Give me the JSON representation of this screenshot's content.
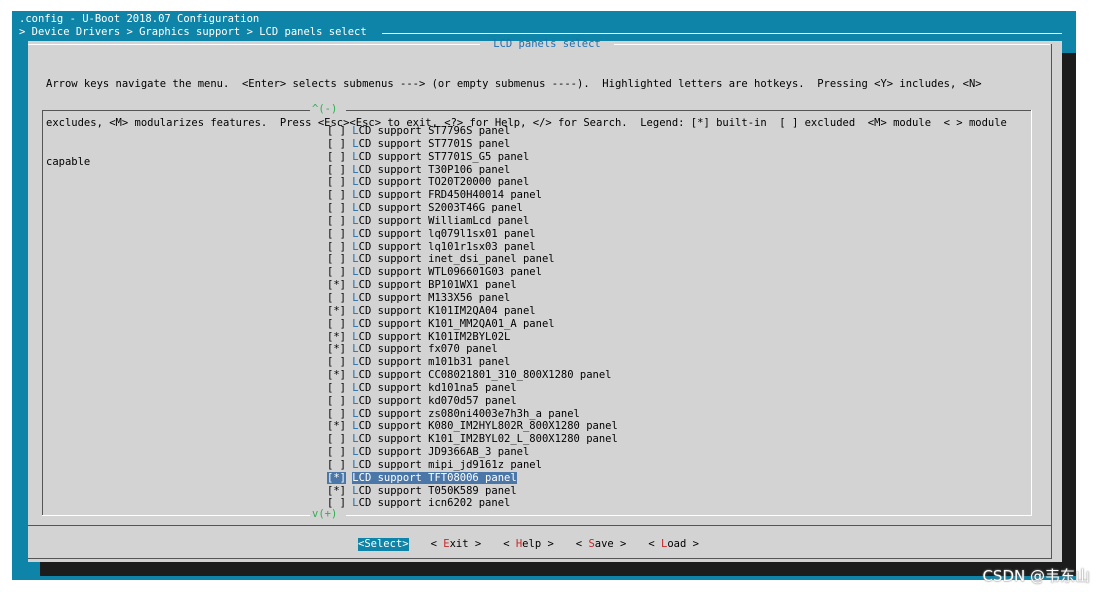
{
  "header": {
    "line1": ".config - U-Boot 2018.07 Configuration",
    "line2": "> Device Drivers > Graphics support > LCD panels select"
  },
  "dialog": {
    "title": "LCD panels select",
    "help": [
      "Arrow keys navigate the menu.  <Enter> selects submenus ---> (or empty submenus ----).  Highlighted letters are hotkeys.  Pressing <Y> includes, <N>",
      "excludes, <M> modularizes features.  Press <Esc><Esc> to exit, <?> for Help, </> for Search.  Legend: [*] built-in  [ ] excluded  <M> module  < > module",
      "capable"
    ],
    "scroll_up": "^(-)",
    "scroll_down": "v(+)"
  },
  "items": [
    {
      "mark": "[ ]",
      "hotkey": "L",
      "rest": "CD support ST7796S panel"
    },
    {
      "mark": "[ ]",
      "hotkey": "L",
      "rest": "CD support ST7701S panel"
    },
    {
      "mark": "[ ]",
      "hotkey": "L",
      "rest": "CD support ST7701S_G5 panel"
    },
    {
      "mark": "[ ]",
      "hotkey": "L",
      "rest": "CD support T30P106 panel"
    },
    {
      "mark": "[ ]",
      "hotkey": "L",
      "rest": "CD support TO20T20000 panel"
    },
    {
      "mark": "[ ]",
      "hotkey": "L",
      "rest": "CD support FRD450H40014 panel"
    },
    {
      "mark": "[ ]",
      "hotkey": "L",
      "rest": "CD support S2003T46G panel"
    },
    {
      "mark": "[ ]",
      "hotkey": "L",
      "rest": "CD support WilliamLcd panel"
    },
    {
      "mark": "[ ]",
      "hotkey": "L",
      "rest": "CD support lq079l1sx01 panel"
    },
    {
      "mark": "[ ]",
      "hotkey": "L",
      "rest": "CD support lq101r1sx03 panel"
    },
    {
      "mark": "[ ]",
      "hotkey": "L",
      "rest": "CD support inet_dsi_panel panel"
    },
    {
      "mark": "[ ]",
      "hotkey": "L",
      "rest": "CD support WTL096601G03 panel"
    },
    {
      "mark": "[*]",
      "hotkey": "L",
      "rest": "CD support BP101WX1 panel"
    },
    {
      "mark": "[ ]",
      "hotkey": "L",
      "rest": "CD support M133X56 panel"
    },
    {
      "mark": "[*]",
      "hotkey": "L",
      "rest": "CD support K101IM2QA04 panel"
    },
    {
      "mark": "[ ]",
      "hotkey": "L",
      "rest": "CD support K101_MM2QA01_A panel"
    },
    {
      "mark": "[*]",
      "hotkey": "L",
      "rest": "CD support K101IM2BYL02L"
    },
    {
      "mark": "[*]",
      "hotkey": "L",
      "rest": "CD support fx070 panel"
    },
    {
      "mark": "[ ]",
      "hotkey": "L",
      "rest": "CD support m101b31 panel"
    },
    {
      "mark": "[*]",
      "hotkey": "L",
      "rest": "CD support CC08021801_310_800X1280 panel"
    },
    {
      "mark": "[ ]",
      "hotkey": "L",
      "rest": "CD support kd101na5 panel"
    },
    {
      "mark": "[ ]",
      "hotkey": "L",
      "rest": "CD support kd070d57 panel"
    },
    {
      "mark": "[ ]",
      "hotkey": "L",
      "rest": "CD support zs080ni4003e7h3h_a panel"
    },
    {
      "mark": "[*]",
      "hotkey": "L",
      "rest": "CD support K080_IM2HYL802R_800X1280 panel"
    },
    {
      "mark": "[ ]",
      "hotkey": "L",
      "rest": "CD support K101_IM2BYL02_L_800X1280 panel"
    },
    {
      "mark": "[ ]",
      "hotkey": "L",
      "rest": "CD support JD9366AB_3 panel"
    },
    {
      "mark": "[ ]",
      "hotkey": "L",
      "rest": "CD support mipi_jd9161z panel"
    },
    {
      "mark": "[*]",
      "hotkey": "L",
      "rest": "CD support TFT08006 panel",
      "selected": true
    },
    {
      "mark": "[*]",
      "hotkey": "L",
      "rest": "CD support T050K589 panel"
    },
    {
      "mark": "[ ]",
      "hotkey": "L",
      "rest": "CD support icn6202 panel"
    }
  ],
  "buttons": [
    {
      "pre": "<",
      "hotkey": "S",
      "rest": "elect>",
      "active": true
    },
    {
      "pre": "< ",
      "hotkey": "E",
      "rest": "xit >"
    },
    {
      "pre": "< ",
      "hotkey": "H",
      "rest": "elp >"
    },
    {
      "pre": "< ",
      "hotkey": "S",
      "rest": "ave >"
    },
    {
      "pre": "< ",
      "hotkey": "L",
      "rest": "oad >"
    }
  ],
  "watermark": "CSDN @韦东山",
  "colors": {
    "terminal_bg": "#0e85a8",
    "dialog_bg": "#d3d3d3",
    "hotkey_item": "#1f6fb0",
    "hotkey_button": "#c62828",
    "selection_bg": "#4a76a8",
    "scroll_indicator": "#2bb24c"
  }
}
